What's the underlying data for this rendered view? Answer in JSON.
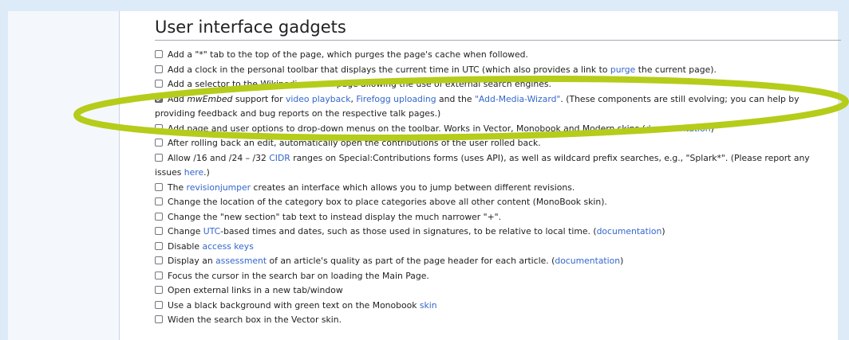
{
  "heading": "User interface gadgets",
  "gadgets": [
    {
      "checked": false,
      "parts": [
        {
          "t": "Add a \"*\" tab to the top of the page, which purges the page's cache when followed."
        }
      ]
    },
    {
      "checked": false,
      "parts": [
        {
          "t": "Add a clock in the personal toolbar that displays the current time in UTC (which also provides a link to "
        },
        {
          "t": "purge",
          "link": true
        },
        {
          "t": " the current page)."
        }
      ]
    },
    {
      "checked": false,
      "parts": [
        {
          "t": "Add a selector to the Wikipedia "
        },
        {
          "t": "search",
          "link": true
        },
        {
          "t": " page allowing the use of external search engines."
        }
      ]
    },
    {
      "checked": true,
      "wrap": true,
      "parts": [
        {
          "t": "Add "
        },
        {
          "t": "mwEmbed",
          "italic": true
        },
        {
          "t": " support for "
        },
        {
          "t": "video playback",
          "link": true
        },
        {
          "t": ", "
        },
        {
          "t": "Firefogg uploading",
          "link": true
        },
        {
          "t": " and the "
        },
        {
          "t": "\"Add-Media-Wizard\"",
          "link": true
        },
        {
          "t": ". (These components are still evolving; you can help by providing feedback and bug reports on the respective talk pages.)"
        }
      ]
    },
    {
      "checked": false,
      "parts": [
        {
          "t": "Add page and user options to drop-down menus on the toolbar. Works in Vector, Monobook and Modern skins ("
        },
        {
          "t": "documentation",
          "link": true
        },
        {
          "t": ")"
        }
      ]
    },
    {
      "checked": false,
      "parts": [
        {
          "t": "After rolling back an edit, automatically open the contributions of the user rolled back."
        }
      ]
    },
    {
      "checked": false,
      "wrap": true,
      "parts": [
        {
          "t": "Allow /16 and /24 – /32 "
        },
        {
          "t": "CIDR",
          "link": true
        },
        {
          "t": " ranges on Special:Contributions forms (uses API), as well as wildcard prefix searches, e.g., \"Splark*\". (Please report any issues "
        },
        {
          "t": "here",
          "link": true
        },
        {
          "t": ".)"
        }
      ]
    },
    {
      "checked": false,
      "parts": [
        {
          "t": "The "
        },
        {
          "t": "revisionjumper",
          "link": true
        },
        {
          "t": " creates an interface which allows you to jump between different revisions."
        }
      ]
    },
    {
      "checked": false,
      "parts": [
        {
          "t": "Change the location of the category box to place categories above all other content (MonoBook skin)."
        }
      ]
    },
    {
      "checked": false,
      "parts": [
        {
          "t": "Change the \"new section\" tab text to instead display the much narrower \"+\"."
        }
      ]
    },
    {
      "checked": false,
      "parts": [
        {
          "t": "Change "
        },
        {
          "t": "UTC",
          "link": true
        },
        {
          "t": "-based times and dates, such as those used in signatures, to be relative to local time. ("
        },
        {
          "t": "documentation",
          "link": true
        },
        {
          "t": ")"
        }
      ]
    },
    {
      "checked": false,
      "parts": [
        {
          "t": "Disable "
        },
        {
          "t": "access keys",
          "link": true
        }
      ]
    },
    {
      "checked": false,
      "parts": [
        {
          "t": "Display an "
        },
        {
          "t": "assessment",
          "link": true
        },
        {
          "t": " of an article's quality as part of the page header for each article. ("
        },
        {
          "t": "documentation",
          "link": true
        },
        {
          "t": ")"
        }
      ]
    },
    {
      "checked": false,
      "parts": [
        {
          "t": "Focus the cursor in the search bar on loading the Main Page."
        }
      ]
    },
    {
      "checked": false,
      "parts": [
        {
          "t": "Open external links in a new tab/window"
        }
      ]
    },
    {
      "checked": false,
      "parts": [
        {
          "t": "Use a black background with green text on the Monobook "
        },
        {
          "t": "skin",
          "link": true
        }
      ]
    },
    {
      "checked": false,
      "parts": [
        {
          "t": "Widen the search box in the Vector skin."
        }
      ]
    }
  ],
  "annotation_color": "#b5cc1a"
}
